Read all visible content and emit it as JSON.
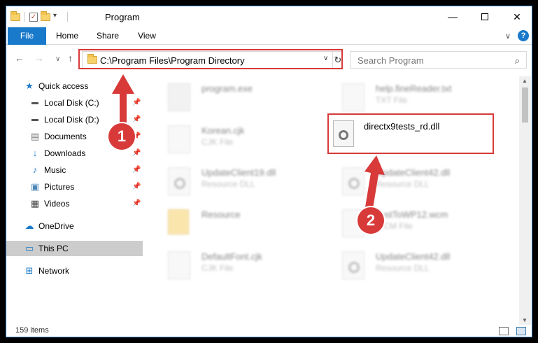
{
  "window": {
    "title": "Program"
  },
  "ribbon": {
    "tabs": [
      "File",
      "Home",
      "Share",
      "View"
    ]
  },
  "address": {
    "path": "C:\\Program Files\\Program Directory"
  },
  "search": {
    "placeholder": "Search Program"
  },
  "sidebar": {
    "items": [
      {
        "label": "Quick access",
        "icon": "star-icon",
        "pinned": false
      },
      {
        "label": "Local Disk (C:)",
        "icon": "drive-icon",
        "pinned": true
      },
      {
        "label": "Local Disk (D:)",
        "icon": "drive-icon",
        "pinned": true
      },
      {
        "label": "Documents",
        "icon": "documents-icon",
        "pinned": true
      },
      {
        "label": "Downloads",
        "icon": "download-icon",
        "pinned": true
      },
      {
        "label": "Music",
        "icon": "music-icon",
        "pinned": true
      },
      {
        "label": "Pictures",
        "icon": "pictures-icon",
        "pinned": true
      },
      {
        "label": "Videos",
        "icon": "videos-icon",
        "pinned": true
      },
      {
        "label": "OneDrive",
        "icon": "cloud-icon",
        "pinned": false
      },
      {
        "label": "This PC",
        "icon": "pc-icon",
        "pinned": false
      },
      {
        "label": "Network",
        "icon": "network-icon",
        "pinned": false
      }
    ]
  },
  "files": [
    {
      "name": "program.exe",
      "type": ""
    },
    {
      "name": "help.fineReader.txt",
      "type": "TXT File"
    },
    {
      "name": "Korean.cjk",
      "type": "CJK File"
    },
    {
      "name": "directx9tests_rd.dll",
      "type": ""
    },
    {
      "name": "UpdateClient19.dll",
      "type": "Resource DLL"
    },
    {
      "name": "UpdateClient42.dll",
      "type": "Resource DLL"
    },
    {
      "name": "Resource",
      "type": ""
    },
    {
      "name": "JustToWP12.wcm",
      "type": "WCM File"
    },
    {
      "name": "DefaultFont.cjk",
      "type": "CJK File"
    },
    {
      "name": "UpdateClient42.dll",
      "type": "Resource DLL"
    }
  ],
  "status": {
    "item_count": "159 items"
  },
  "annotations": {
    "badge1": "1",
    "badge2": "2",
    "color": "#d83a3a"
  }
}
